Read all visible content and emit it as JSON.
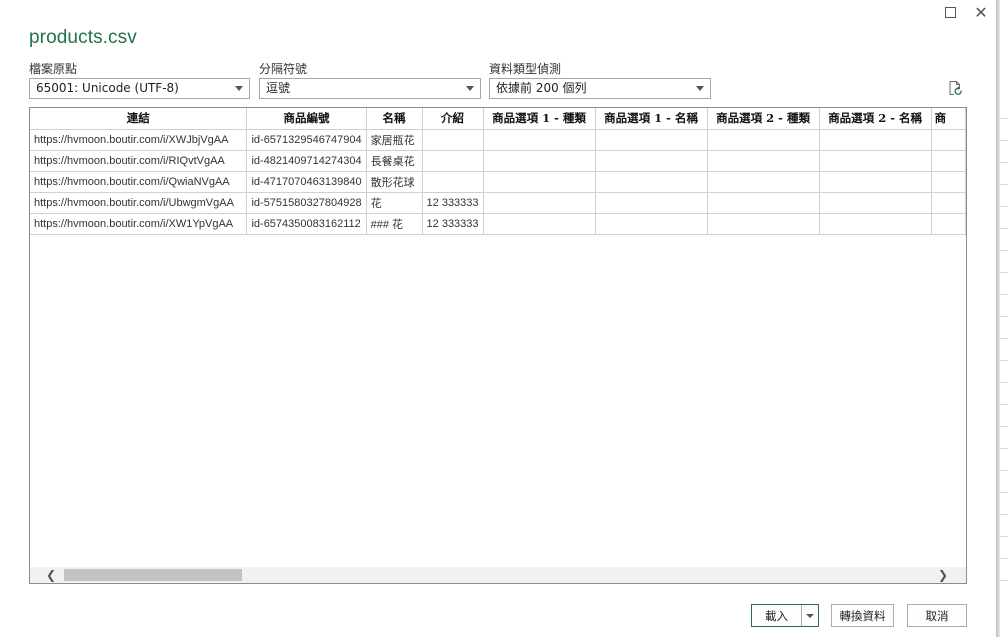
{
  "window": {
    "title": "products.csv",
    "maximize_icon": "maximize-icon",
    "close_icon": "close-icon",
    "close_glyph": "✕"
  },
  "options": {
    "file_origin": {
      "label": "檔案原點",
      "value": "65001: Unicode (UTF-8)"
    },
    "delimiter": {
      "label": "分隔符號",
      "value": "逗號"
    },
    "type_detection": {
      "label": "資料類型偵測",
      "value": "依據前 200 個列"
    }
  },
  "table": {
    "columns": [
      "連結",
      "商品編號",
      "名稱",
      "介紹",
      "商品選項 1 - 種類",
      "商品選項 1 - 名稱",
      "商品選項 2 - 種類",
      "商品選項 2 - 名稱",
      "商"
    ],
    "rows": [
      [
        "https://hvmoon.boutir.com/i/XWJbjVgAA",
        "id-6571329546747904",
        "家居瓶花",
        "",
        "",
        "",
        "",
        "",
        ""
      ],
      [
        "https://hvmoon.boutir.com/i/RIQvtVgAA",
        "id-4821409714274304",
        "長餐桌花",
        "",
        "",
        "",
        "",
        "",
        ""
      ],
      [
        "https://hvmoon.boutir.com/i/QwiaNVgAA",
        "id-4717070463139840",
        "散形花球",
        "",
        "",
        "",
        "",
        "",
        ""
      ],
      [
        "https://hvmoon.boutir.com/i/UbwgmVgAA",
        "id-5751580327804928",
        "花",
        "12 333333",
        "",
        "",
        "",
        "",
        ""
      ],
      [
        "https://hvmoon.boutir.com/i/XW1YpVgAA",
        "id-6574350083162112",
        "### 花",
        "12 333333",
        "",
        "",
        "",
        "",
        ""
      ]
    ]
  },
  "buttons": {
    "load": "載入",
    "transform": "轉換資料",
    "cancel": "取消"
  },
  "colors": {
    "accent": "#217346",
    "border": "#a6a6a6"
  }
}
